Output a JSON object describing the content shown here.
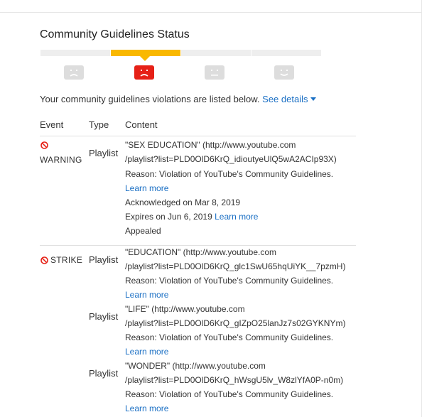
{
  "page_title": "Community Guidelines Status",
  "status_faces": [
    "sad-face-icon",
    "angry-face-icon",
    "neutral-face-icon",
    "happy-face-icon"
  ],
  "colors": {
    "active": "#f9b800",
    "active_face": "#e62117",
    "inactive": "#dddddd",
    "link": "#1a6fc4"
  },
  "intro": {
    "text": "Your community guidelines violations are listed below.",
    "link": "See details"
  },
  "table": {
    "headers": [
      "Event",
      "Type",
      "Content"
    ],
    "warning": {
      "event": "WARNING",
      "type": "Playlist",
      "lines": [
        "\"SEX EDUCATION\" (http://www.youtube.com",
        "/playlist?list=PLD0OlD6KrQ_idioutyeUlQ5wA2ACIp93X)",
        "Reason: Violation of YouTube's Community Guidelines."
      ],
      "learn_more": "Learn more",
      "acknowledged": "Acknowledged on Mar 8, 2019",
      "expires": "Expires on Jun 6, 2019",
      "expires_link": "Learn more",
      "status": "Appealed"
    },
    "strike": {
      "event": "STRIKE",
      "items": [
        {
          "type": "Playlist",
          "lines": [
            "\"EDUCATION\" (http://www.youtube.com",
            "/playlist?list=PLD0OlD6KrQ_glc1SwU65hqUiYK__7pzmH)",
            "Reason: Violation of YouTube's Community Guidelines."
          ],
          "learn_more": "Learn more"
        },
        {
          "type": "Playlist",
          "lines": [
            "\"LIFE\" (http://www.youtube.com",
            "/playlist?list=PLD0OlD6KrQ_gIZpO25lanJz7s02GYKNYm)",
            "Reason: Violation of YouTube's Community Guidelines."
          ],
          "learn_more": "Learn more"
        },
        {
          "type": "Playlist",
          "lines": [
            "\"WONDER\" (http://www.youtube.com",
            "/playlist?list=PLD0OlD6KrQ_hWsgU5lv_W8zlYfA0P-n0m)",
            "Reason: Violation of YouTube's Community Guidelines."
          ],
          "learn_more": "Learn more"
        }
      ]
    }
  }
}
